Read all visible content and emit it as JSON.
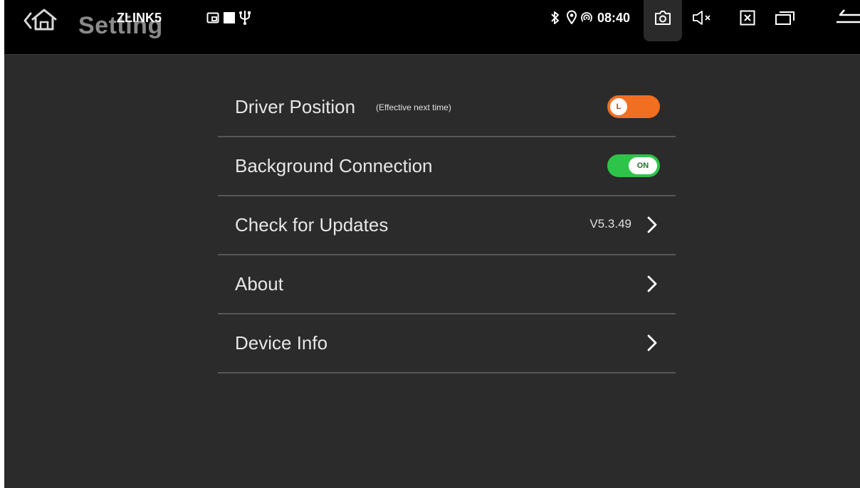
{
  "statusbar": {
    "title": "Setting",
    "app_label": "ZLINK5",
    "time": "08:40",
    "icons": {
      "home": "home-icon",
      "cast": "cast-icon",
      "square": "square-icon",
      "usb": "usb-icon",
      "bluetooth": "bluetooth-icon",
      "location": "location-icon",
      "hotspot": "hotspot-icon",
      "screenshot": "camera-icon",
      "volume": "volume-mute-icon",
      "close_app": "close-box-icon",
      "recents": "recents-icon",
      "back": "back-icon"
    }
  },
  "settings": {
    "driver_position": {
      "label": "Driver Position",
      "note": "(Effective next time)",
      "toggle_text": "L",
      "color": "#f26f21"
    },
    "background_connection": {
      "label": "Background Connection",
      "toggle_text": "ON",
      "color": "#2ec44a"
    },
    "check_updates": {
      "label": "Check for Updates",
      "version": "V5.3.49"
    },
    "about": {
      "label": "About"
    },
    "device_info": {
      "label": "Device Info"
    }
  }
}
